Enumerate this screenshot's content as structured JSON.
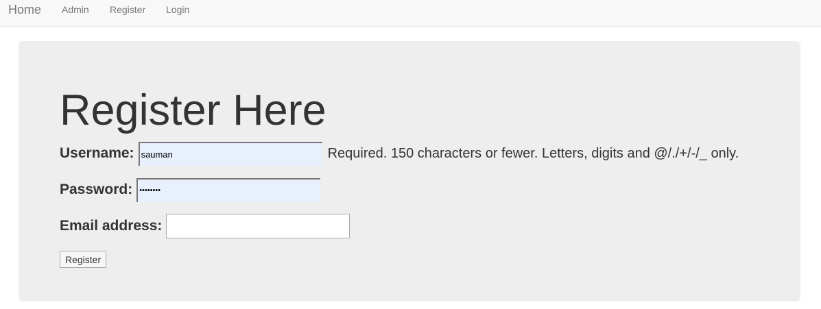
{
  "navbar": {
    "brand": "Home",
    "links": [
      {
        "label": "Admin"
      },
      {
        "label": "Register"
      },
      {
        "label": "Login"
      }
    ]
  },
  "form": {
    "title": "Register Here",
    "username": {
      "label": "Username:",
      "value": "sauman",
      "help": "Required. 150 characters or fewer. Letters, digits and @/./+/-/_ only."
    },
    "password": {
      "label": "Password:",
      "value": "••••••••"
    },
    "email": {
      "label": "Email address:",
      "value": ""
    },
    "submit_label": "Register"
  },
  "colors": {
    "navbar_bg": "#f8f8f8",
    "panel_bg": "#eeeeee",
    "autofill_bg": "#e8effd",
    "text": "#333333",
    "nav_text": "#777777"
  }
}
